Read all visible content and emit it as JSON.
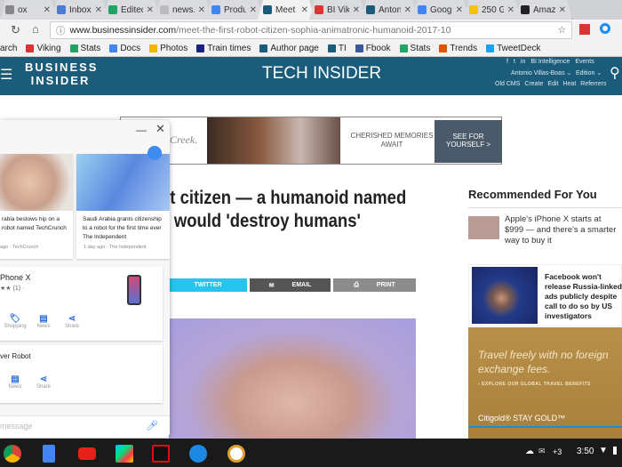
{
  "tabs": [
    {
      "title": "ox",
      "color": "#888"
    },
    {
      "title": "Inbox",
      "color": "#4a7bd6"
    },
    {
      "title": "Edited",
      "color": "#1fa463"
    },
    {
      "title": "news.",
      "color": "#bbb"
    },
    {
      "title": "Produ",
      "color": "#4285f4"
    },
    {
      "title": "Meet",
      "color": "#1b5c7a",
      "active": true
    },
    {
      "title": "BI Vik",
      "color": "#d33"
    },
    {
      "title": "Anton",
      "color": "#1b5c7a"
    },
    {
      "title": "Googl",
      "color": "#4285f4"
    },
    {
      "title": "250 G",
      "color": "#f4c20d"
    },
    {
      "title": "Amaz",
      "color": "#222"
    }
  ],
  "address": {
    "domain": "www.businessinsider.com",
    "path": "/meet-the-first-robot-citizen-sophia-animatronic-humanoid-2017-10"
  },
  "bookmarks": [
    {
      "label": "arch",
      "color": "transparent"
    },
    {
      "label": "Viking",
      "color": "#d33"
    },
    {
      "label": "Stats",
      "color": "#1fa463"
    },
    {
      "label": "Docs",
      "color": "#4285f4"
    },
    {
      "label": "Photos",
      "color": "#f4b400"
    },
    {
      "label": "Train times",
      "color": "#1a237e"
    },
    {
      "label": "Author page",
      "color": "#1b5c7a"
    },
    {
      "label": "TI",
      "color": "#1b5c7a"
    },
    {
      "label": "Fbook",
      "color": "#3b5998"
    },
    {
      "label": "Stats",
      "color": "#1fa463"
    },
    {
      "label": "Trends",
      "color": "#e65100"
    },
    {
      "label": "TweetDeck",
      "color": "#1da1f2"
    }
  ],
  "site": {
    "logo": "BUSINESS INSIDER",
    "section": "TECH INSIDER",
    "top_links": [
      "f",
      "t",
      "in",
      "BI Intelligence",
      "Events"
    ],
    "user": "Antonio Villas-Boas ⌄",
    "edition": "Edition ⌄",
    "admin_links": [
      "Old CMS",
      "Create",
      "Edit",
      "Heat",
      "Referrers"
    ]
  },
  "ad": {
    "brand": "Creek.",
    "text": "CHERISHED MEMORIES AWAIT",
    "cta": "SEE FOR YOURSELF >"
  },
  "article": {
    "headline_1": "ot citizen — a humanoid named",
    "headline_2": "would 'destroy humans'",
    "share": {
      "twitter": "TWITTER",
      "email": "EMAIL",
      "print": "PRINT"
    }
  },
  "sidebar": {
    "title": "Recommended For You",
    "item1": "Apple's iPhone X starts at $999 — and there's a smarter way to buy it",
    "item2": "Facebook won't release Russia-linked ads publicly despite call to do so by US investigators",
    "ad_text": "Travel freely with no foreign exchange fees.",
    "ad_link": "› EXPLORE OUR GLOBAL TRAVEL BENEFITS",
    "ad_brand": "Citigold® STAY GOLD™"
  },
  "assistant": {
    "news1": {
      "title": "rabia bestows hip on a robot named TechCrunch",
      "meta": "ago · TechCrunch"
    },
    "news2": {
      "title": "Saudi Arabia grants citizenship to a robot for the first time ever The Independent",
      "meta": "1 day ago · The Independent"
    },
    "product": {
      "name": "Phone X",
      "rating": "★★ (1) ·"
    },
    "actions1": [
      "Shopping",
      "News",
      "Share"
    ],
    "topic": "ver Robot",
    "actions2": [
      "News",
      "Share"
    ],
    "input_placeholder": "message"
  },
  "shelf": {
    "time": "3:50",
    "notif": "+3"
  }
}
